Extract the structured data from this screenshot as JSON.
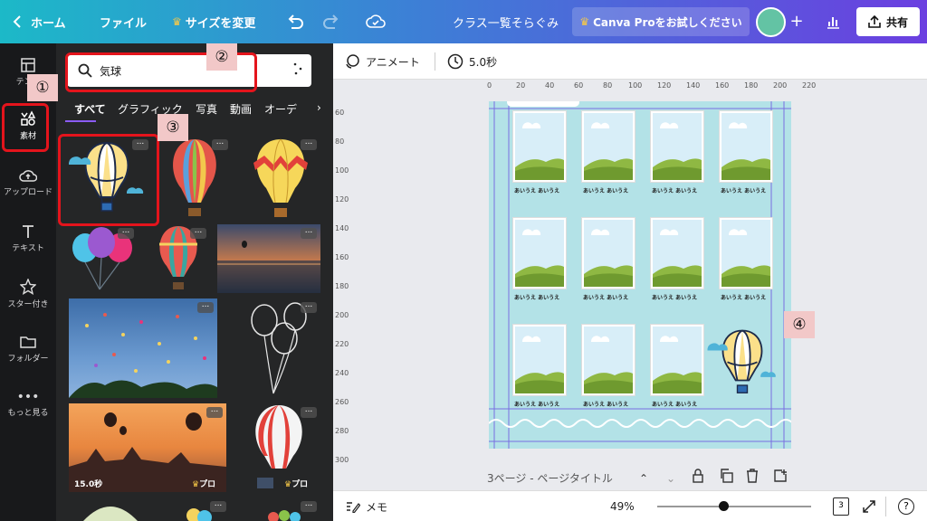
{
  "topbar": {
    "home_label": "ホーム",
    "file_label": "ファイル",
    "resize_label": "サイズを変更",
    "doc_title": "クラス一覧そらぐみ",
    "pro_label": "Canva Proをお試しください",
    "share_label": "共有"
  },
  "rail": {
    "items": [
      {
        "label": "テンプ"
      },
      {
        "label": "素材"
      },
      {
        "label": "アップロード"
      },
      {
        "label": "テキスト"
      },
      {
        "label": "スター付き"
      },
      {
        "label": "フォルダー"
      },
      {
        "label": "もっと見る"
      }
    ]
  },
  "panel": {
    "search_value": "気球",
    "tabs": [
      "すべて",
      "グラフィック",
      "写真",
      "動画",
      "オーデ"
    ],
    "video_duration": "15.0秒",
    "pro_badge": "プロ"
  },
  "toolbar": {
    "animate_label": "アニメート",
    "duration_label": "5.0秒"
  },
  "ruler": {
    "top": [
      "0",
      "20",
      "40",
      "60",
      "80",
      "100",
      "120",
      "140",
      "160",
      "180",
      "200",
      "220"
    ],
    "left": [
      "60",
      "80",
      "100",
      "120",
      "140",
      "160",
      "180",
      "200",
      "220",
      "240",
      "260",
      "280",
      "300"
    ]
  },
  "design": {
    "thumb_label": "あいうえ あいうえ"
  },
  "page_info": {
    "title": "3ページ - ページタイトル"
  },
  "footer": {
    "notes_label": "メモ",
    "zoom": "49%",
    "page_count": "3",
    "zoom_level": 0.49
  },
  "annotations": {
    "markers": [
      "①",
      "②",
      "③",
      "④"
    ]
  },
  "colors": {
    "accent": "#8b5cf6",
    "highlight": "#e4141c",
    "page_bg": "#b3e2e7"
  }
}
